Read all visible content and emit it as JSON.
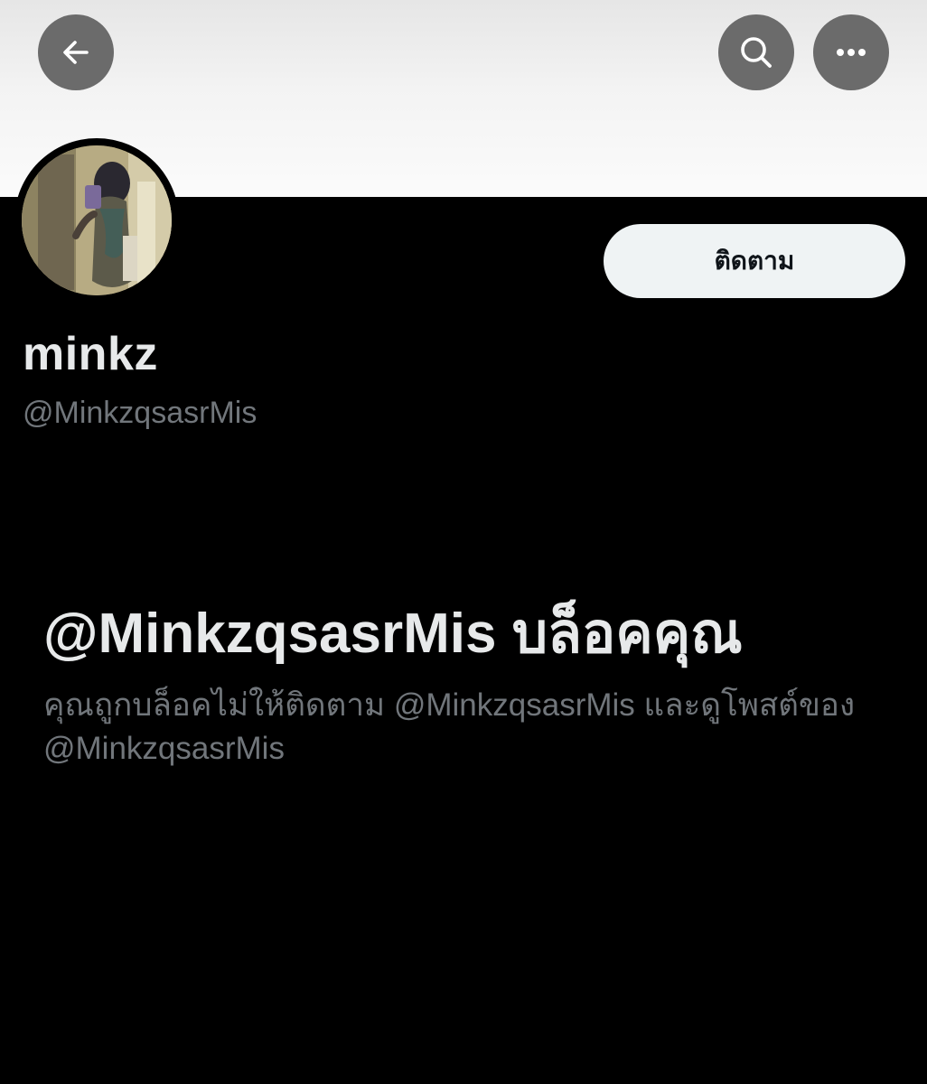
{
  "header": {
    "back_icon": "arrow-left-icon",
    "search_icon": "search-icon",
    "more_icon": "more-horizontal-icon"
  },
  "profile": {
    "display_name": "minkz",
    "handle": "@MinkzqsasrMis",
    "follow_label": "ติดตาม"
  },
  "blocked": {
    "title": "@MinkzqsasrMis บล็อคคุณ",
    "description": "คุณถูกบล็อคไม่ให้ติดตาม @MinkzqsasrMis และดูโพสต์ของ @MinkzqsasrMis"
  },
  "colors": {
    "background": "#000000",
    "primary_text": "#e7e9ea",
    "secondary_text": "#71767b",
    "follow_button_bg": "#eff3f4"
  }
}
